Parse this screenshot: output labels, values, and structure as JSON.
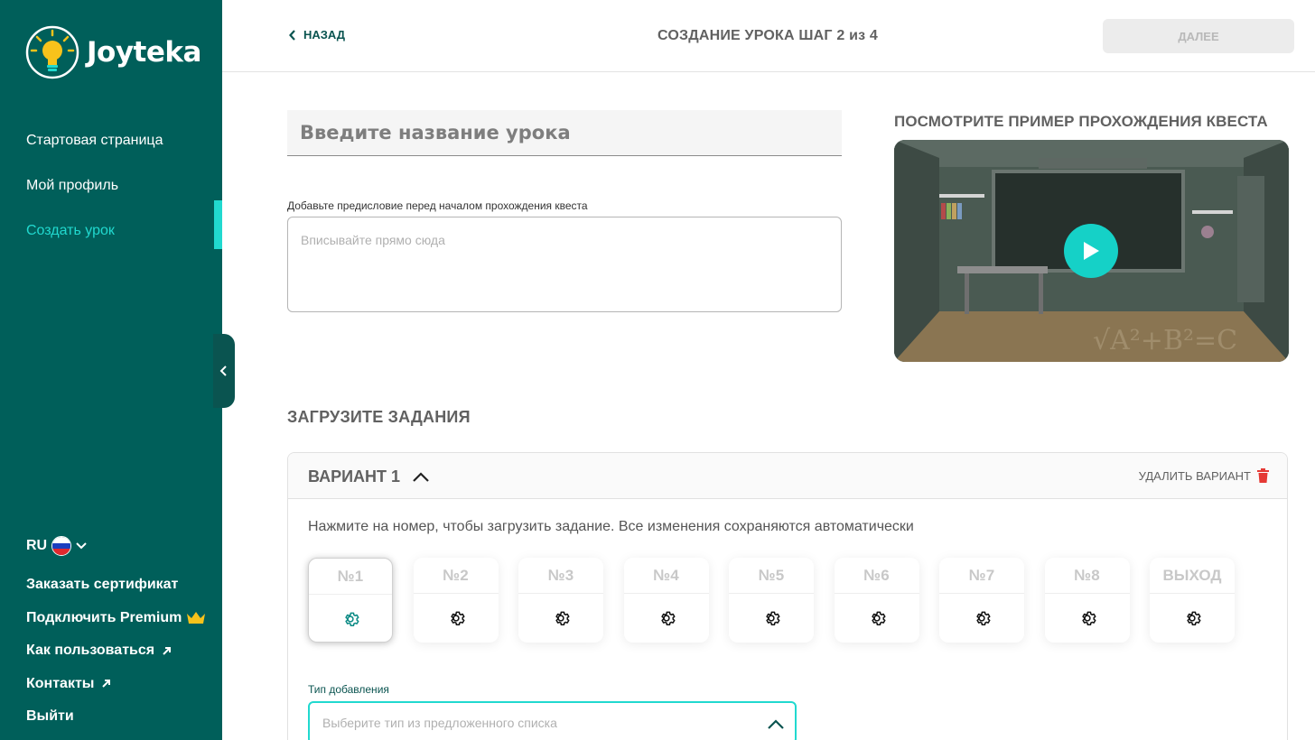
{
  "brand": {
    "name": "Joyteka"
  },
  "sidebar": {
    "items": [
      {
        "label": "Стартовая страница"
      },
      {
        "label": "Мой профиль"
      },
      {
        "label": "Создать урок"
      }
    ],
    "lang": "RU",
    "links": [
      {
        "label": "Заказать сертификат"
      },
      {
        "label": "Подключить Premium"
      },
      {
        "label": "Как пользоваться"
      },
      {
        "label": "Контакты"
      },
      {
        "label": "Выйти"
      }
    ]
  },
  "header": {
    "back": "НАЗАД",
    "title": "СОЗДАНИЕ УРОКА ШАГ 2 из 4",
    "next": "ДАЛЕЕ"
  },
  "lesson": {
    "name_placeholder": "Введите название урока",
    "preface_label": "Добавьте предисловие перед началом прохождения квеста",
    "preface_placeholder": "Вписывайте прямо сюда"
  },
  "video": {
    "title": "ПОСМОТРИТЕ ПРИМЕР ПРОХОЖДЕНИЯ КВЕСТА",
    "board_text": "√A²+B²=C"
  },
  "tasks": {
    "title": "ЗАГРУЗИТЕ ЗАДАНИЯ",
    "variant": {
      "name": "ВАРИАНТ 1",
      "delete": "УДАЛИТЬ ВАРИАНТ",
      "hint": "Нажмите на номер, чтобы загрузить задание. Все изменения сохраняются автоматически",
      "slots": [
        "№1",
        "№2",
        "№3",
        "№4",
        "№5",
        "№6",
        "№7",
        "№8",
        "ВЫХОД"
      ],
      "type_label": "Тип добавления",
      "type_placeholder": "Выберите тип из предложенного списка"
    }
  },
  "colors": {
    "sidebar": "#005f5a",
    "accent": "#21d9cf",
    "active_gear": "#0a8a84"
  }
}
